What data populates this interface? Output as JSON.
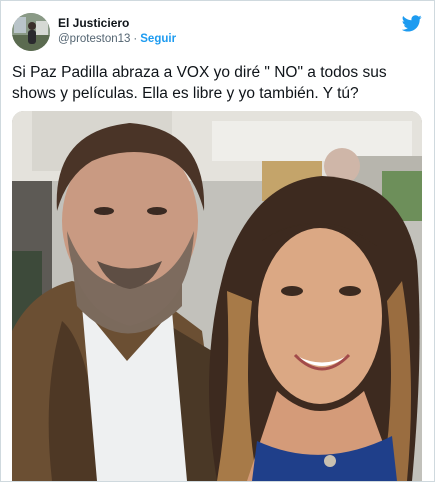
{
  "tweet": {
    "author": {
      "display_name": "El Justiciero",
      "handle": "@proteston13",
      "separator": "·",
      "follow_label": "Seguir",
      "avatar_icon": "user-avatar",
      "platform_icon": "twitter-bird-icon"
    },
    "text": "Si Paz Padilla abraza a VOX yo diré \" NO\" a todos sus shows y películas. Ella es libre y yo también. Y tú?",
    "media": {
      "type": "photo",
      "icon": "photo-selfie"
    }
  },
  "colors": {
    "accent": "#1d9bf0",
    "text_primary": "#0f1419",
    "text_secondary": "#536471",
    "border": "#cfd9de"
  }
}
